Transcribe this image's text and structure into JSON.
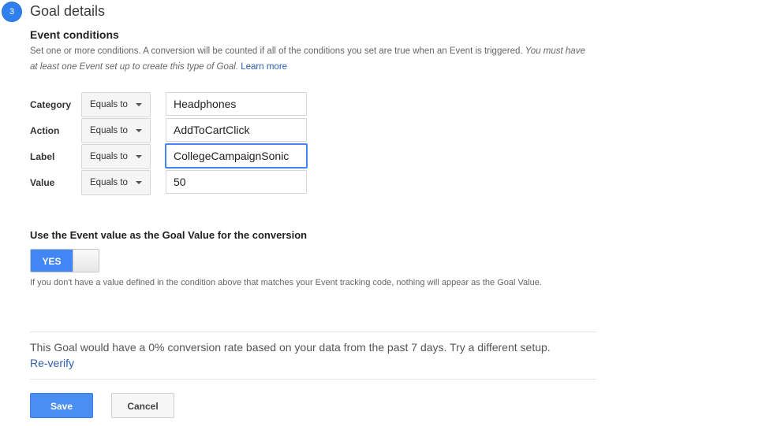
{
  "step": {
    "number": "3",
    "title": "Goal details"
  },
  "event_conditions": {
    "title": "Event conditions",
    "help_text": "Set one or more conditions. A conversion will be counted if all of the conditions you set are true when an Event is triggered.",
    "help_italic": "You must have at least one Event set up to create this type of Goal.",
    "learn_more": "Learn more",
    "rows": [
      {
        "label": "Category",
        "operator": "Equals to",
        "value": "Headphones"
      },
      {
        "label": "Action",
        "operator": "Equals to",
        "value": "AddToCartClick"
      },
      {
        "label": "Label",
        "operator": "Equals to",
        "value": "CollegeCampaignSonic"
      },
      {
        "label": "Value",
        "operator": "Equals to",
        "value": "50"
      }
    ]
  },
  "goal_value": {
    "title": "Use the Event value as the Goal Value for the conversion",
    "toggle_label": "YES",
    "toggle_state": true,
    "help_text": "If you don't have a value defined in the condition above that matches your Event tracking code, nothing will appear as the Goal Value."
  },
  "verification": {
    "message": "This Goal would have a 0% conversion rate based on your data from the past 7 days. Try a different setup.",
    "reverify_label": "Re-verify"
  },
  "actions": {
    "save_label": "Save",
    "cancel_label": "Cancel"
  },
  "colors": {
    "accent": "#4285f4",
    "link": "#2a5db0"
  }
}
